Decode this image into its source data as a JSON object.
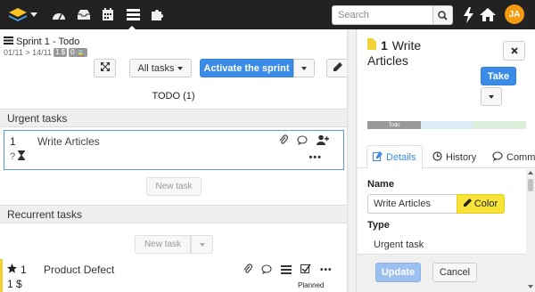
{
  "topbar": {
    "search_placeholder": "Search",
    "avatar_initials": "JA",
    "accent": "#f39c12"
  },
  "sprint": {
    "title": "Sprint 1 - Todo",
    "dates": "01/11 > 14/11",
    "badge_velocity": "1 $",
    "badge_count": "0 ",
    "filter_label": "All tasks",
    "activate_label": "Activate the sprint",
    "todo_header": "TODO (1)"
  },
  "sections": {
    "urgent": "Urgent tasks",
    "recurrent": "Recurrent tasks"
  },
  "urgent_task": {
    "number": "1",
    "name": "Write Articles",
    "estimate": "?"
  },
  "new_task_label": "New task",
  "product_task": {
    "number": "1",
    "name": "Product Defect",
    "value": "1 $",
    "status": "Planned",
    "color": "#f1d335"
  },
  "detail": {
    "number": "1",
    "title_line1": "Write",
    "title_line2": "Articles",
    "take_label": "Take",
    "progress": [
      {
        "label": "Todo",
        "color": "#999999"
      },
      {
        "label": "",
        "color": "#d9ecf8"
      },
      {
        "label": "",
        "color": "#dbf0da"
      }
    ],
    "tabs": [
      "Details",
      "History",
      "Comme"
    ],
    "name_label": "Name",
    "name_value": "Write Articles",
    "color_label": "Color",
    "type_label": "Type",
    "type_value": "Urgent task",
    "update_label": "Update",
    "cancel_label": "Cancel"
  }
}
